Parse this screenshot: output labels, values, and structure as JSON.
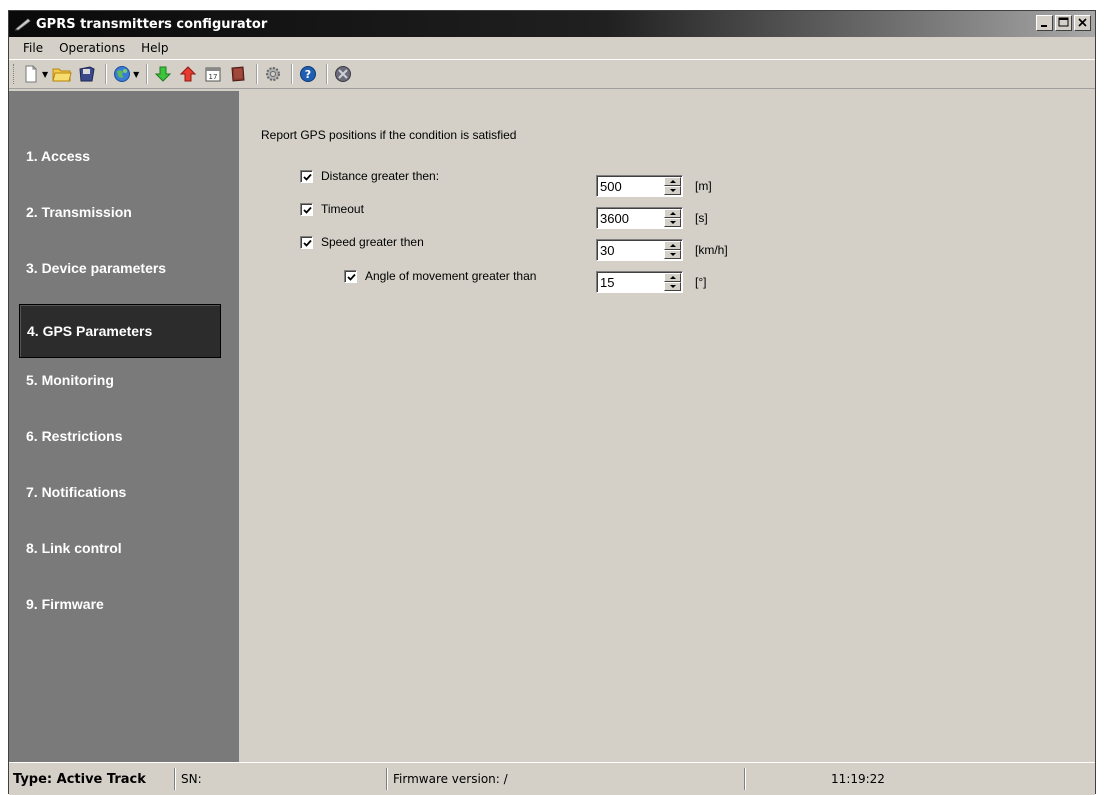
{
  "window": {
    "title": "GPRS transmitters configurator",
    "title_icon": "pen-icon",
    "controls": [
      "minimize-icon",
      "maximize-icon",
      "close-icon"
    ]
  },
  "menu": {
    "file": "File",
    "operations": "Operations",
    "help": "Help"
  },
  "toolbar": {
    "icons": [
      "new-file-icon",
      "open-folder-icon",
      "save-icon",
      "connect-globe-icon",
      "download-arrow-icon",
      "upload-arrow-icon",
      "calendar-icon",
      "book-icon",
      "settings-gear-icon",
      "help-icon",
      "disconnect-icon"
    ]
  },
  "sidebar": {
    "items": [
      {
        "label": "1. Access"
      },
      {
        "label": "2. Transmission"
      },
      {
        "label": "3. Device parameters"
      },
      {
        "label": "4. GPS Parameters",
        "active": true
      },
      {
        "label": "5. Monitoring"
      },
      {
        "label": "6. Restrictions"
      },
      {
        "label": "7. Notifications"
      },
      {
        "label": "8. Link control"
      },
      {
        "label": "9. Firmware"
      }
    ]
  },
  "gps": {
    "heading": "Report GPS positions if the condition is satisfied",
    "rows": [
      {
        "label": "Distance greater then:",
        "checked": true,
        "value": "500",
        "unit": "[m]"
      },
      {
        "label": "Timeout",
        "checked": true,
        "value": "3600",
        "unit": "[s]"
      },
      {
        "label": "Speed greater then",
        "checked": true,
        "value": "30",
        "unit": "[km/h]"
      },
      {
        "label": "Angle of movement greater than",
        "checked": true,
        "value": "15",
        "unit": "[°]"
      }
    ]
  },
  "status": {
    "type": "Type: Active Track",
    "sn": "SN:",
    "firmware": "Firmware version: /",
    "time": "11:19:22"
  },
  "colors": {
    "sidebar_bg": "#7a7a7a",
    "active_item_bg": "#2c2c2c",
    "panel_bg": "#d4d0c8"
  }
}
